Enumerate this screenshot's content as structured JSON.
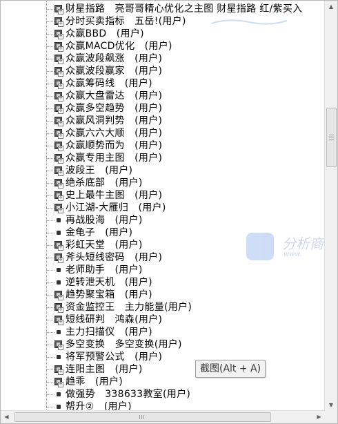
{
  "tree": {
    "items": [
      {
        "label": "财星指路　亮哥哥精心优化之主图 财星指路 红/紫买入",
        "icon": "indicator-node-icon"
      },
      {
        "label": "分时买卖指标　五岳!(用户)",
        "icon": "indicator-node-icon"
      },
      {
        "label": "众赢BBD　(用户)",
        "icon": "indicator-node-icon"
      },
      {
        "label": "众赢MACD优化　(用户)",
        "icon": "indicator-node-icon"
      },
      {
        "label": "众赢波段飙涨　(用户)",
        "icon": "indicator-node-icon"
      },
      {
        "label": "众赢波段赢家　(用户)",
        "icon": "indicator-node-icon"
      },
      {
        "label": "众赢筹码线　(用户)",
        "icon": "indicator-node-icon"
      },
      {
        "label": "众赢大盘雷达　(用户)",
        "icon": "indicator-node-icon"
      },
      {
        "label": "众赢多空趋势　(用户)",
        "icon": "indicator-node-icon"
      },
      {
        "label": "众赢风洞判势　(用户)",
        "icon": "indicator-node-icon"
      },
      {
        "label": "众赢六六大顺　(用户)",
        "icon": "indicator-node-icon"
      },
      {
        "label": "众赢顺势而为　(用户)",
        "icon": "indicator-node-icon"
      },
      {
        "label": "众赢专用主图　(用户)",
        "icon": "indicator-node-icon"
      },
      {
        "label": "波段王　(用户)",
        "icon": "indicator-node-icon"
      },
      {
        "label": "绝杀底部　(用户)",
        "icon": "indicator-node-icon"
      },
      {
        "label": "史上最牛主图　(用户)",
        "icon": "indicator-node-icon"
      },
      {
        "label": "小江湖-大雁归　(用户)",
        "icon": "indicator-node-icon"
      },
      {
        "label": "再战股海　(用户)",
        "icon": "bullet-icon"
      },
      {
        "label": "金龟子　(用户)",
        "icon": "bullet-icon"
      },
      {
        "label": "彩虹天堂　(用户)",
        "icon": "indicator-node-icon"
      },
      {
        "label": "斧头短线密码　(用户)",
        "icon": "indicator-node-icon"
      },
      {
        "label": "老师助手　(用户)",
        "icon": "bullet-icon"
      },
      {
        "label": "逆转泄天机　(用户)",
        "icon": "bullet-icon"
      },
      {
        "label": "趋势聚宝箱　(用户)",
        "icon": "indicator-node-icon"
      },
      {
        "label": "资金监控王　主力能量(用户)",
        "icon": "indicator-node-icon"
      },
      {
        "label": "短线研判　鸿森(用户)",
        "icon": "indicator-node-icon"
      },
      {
        "label": "主力扫描仪　(用户)",
        "icon": "bullet-icon"
      },
      {
        "label": "多空变换　多空变换(用户)",
        "icon": "indicator-node-icon"
      },
      {
        "label": "将军预警公式　(用户)",
        "icon": "bullet-icon"
      },
      {
        "label": "连阳主图　(用户)",
        "icon": "indicator-node-icon"
      },
      {
        "label": "趋乖　(用户)",
        "icon": "indicator-node-icon"
      },
      {
        "label": "做强势　338633教室(用户)",
        "icon": "bullet-icon"
      },
      {
        "label": "帮升②　(用户)",
        "icon": "bullet-icon"
      }
    ]
  },
  "tooltip": {
    "text": "截图(Alt + A)"
  },
  "scrollbar": {
    "up_icon": "scroll-up-arrow-icon",
    "down_icon": "scroll-down-arrow-icon",
    "left_icon": "scroll-left-arrow-icon",
    "right_icon": "scroll-right-arrow-icon"
  },
  "colors": {
    "text": "#000000",
    "tooltip_bg": "#f2f2f2",
    "scroll_bg": "#f0f0f0",
    "watermark": "#1f4fbf"
  }
}
